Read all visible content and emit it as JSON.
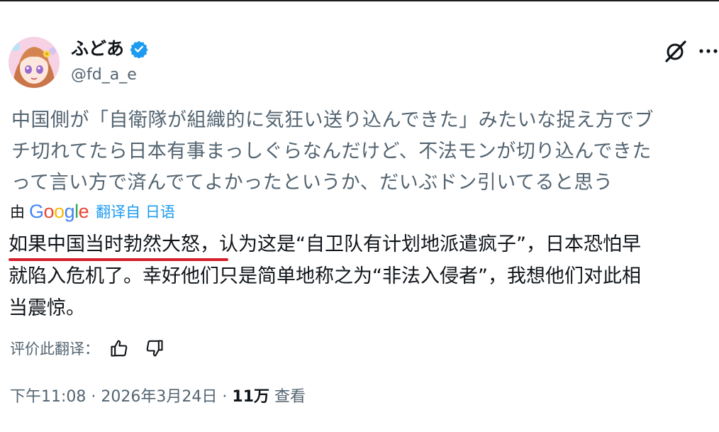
{
  "author": {
    "display_name": "ふどあ",
    "handle": "@fd_a_e",
    "avatar_icon": "anime-girl-avatar",
    "verified_icon": "verified-badge-icon"
  },
  "header_actions": {
    "grok_icon": "grok-icon",
    "more_icon": "more-icon"
  },
  "post": {
    "original_lines": [
      "中国側が「自衛隊が組織的に気狂い送り込んできた」みたいな捉え方でブ",
      "チ切れてたら日本有事まっしぐらなんだけど、不法モンが切り込んできた",
      "って言い方で済んでてよかったというか、だいぶドン引いてると思う"
    ],
    "translation_by_label": "由",
    "translation_source": "Google",
    "translated_from_label": "翻译自 日语",
    "translated_lines": [
      "如果中国当时勃然大怒，认为这是“自卫队有计划地派遣疯子”，日本恐怕早",
      "就陷入危机了。幸好他们只是简单地称之为“非法入侵者”，我想他们对此相",
      "当震惊。"
    ],
    "rate_label": "评价此翻译："
  },
  "meta": {
    "time": "下午11:08",
    "date": "2026年3月24日",
    "separator": "·",
    "views": "11万",
    "views_label": "查看"
  },
  "colors": {
    "text": "#0f1419",
    "secondary": "#536471",
    "link": "#1d9bf0",
    "verified": "#1d9bf0",
    "underline": "#d4202c"
  }
}
